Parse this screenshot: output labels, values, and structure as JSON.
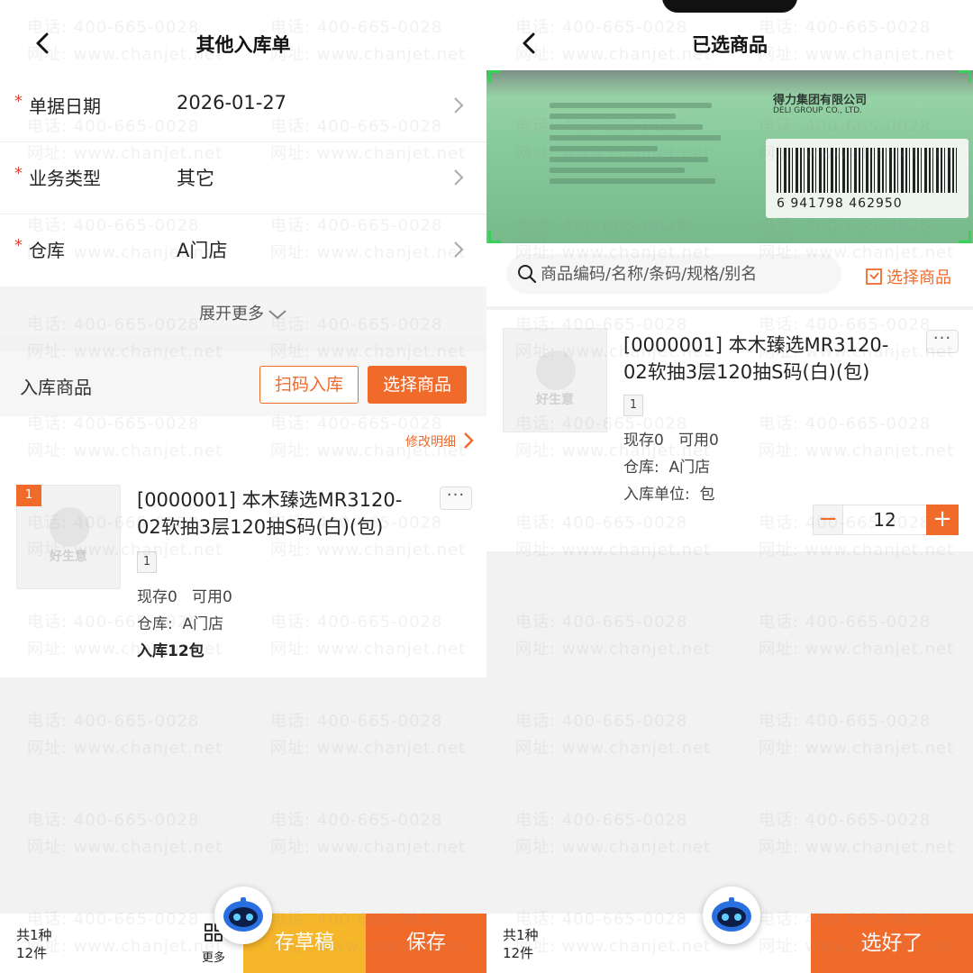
{
  "left": {
    "title": "其他入库单",
    "form": [
      {
        "label": "单据日期",
        "value": "2026-01-27"
      },
      {
        "label": "业务类型",
        "value": "其它"
      },
      {
        "label": "仓库",
        "value": "A门店"
      }
    ],
    "expand_more": "展开更多",
    "goods_header": "入库商品",
    "scan_button": "扫码入库",
    "select_button": "选择商品",
    "edit_detail": "修改明细",
    "item": {
      "index": "1",
      "name_line1": "[0000001] 本木臻选MR3120-",
      "name_line2": "02软抽3层120抽S码(白)(包)",
      "tag": "1",
      "stock": "现存0   可用0",
      "warehouse": "仓库:  A门店",
      "inbound": "入库12包",
      "thumb_brand": "好生意"
    },
    "bottom": {
      "total_kinds": "共1种",
      "total_count": "12件",
      "more": "更多",
      "draft": "存草稿",
      "save": "保存"
    }
  },
  "right": {
    "title": "已选商品",
    "scan": {
      "company": "得力集团有限公司",
      "company_en": "DELI GROUP CO., LTD.",
      "barcode": "6 941798 462950"
    },
    "search": {
      "placeholder": "商品编码/名称/条码/规格/别名"
    },
    "select_goods": "选择商品",
    "item": {
      "name_line1": "[0000001] 本木臻选MR3120-",
      "name_line2": "02软抽3层120抽S码(白)(包)",
      "tag": "1",
      "stock": "现存0   可用0",
      "warehouse": "仓库:  A门店",
      "unit": "入库单位:  包",
      "quantity": "12",
      "thumb_brand": "好生意"
    },
    "bottom": {
      "total_kinds": "共1种",
      "total_count": "12件",
      "done": "选好了"
    }
  },
  "watermark": {
    "phone": "电话: 400-665-0028",
    "site": "网址: www.chanjet.net"
  },
  "colors": {
    "accent": "#f06a2a",
    "draft": "#f6b62a",
    "required": "#e8432c",
    "scan_frame": "#38d158"
  }
}
